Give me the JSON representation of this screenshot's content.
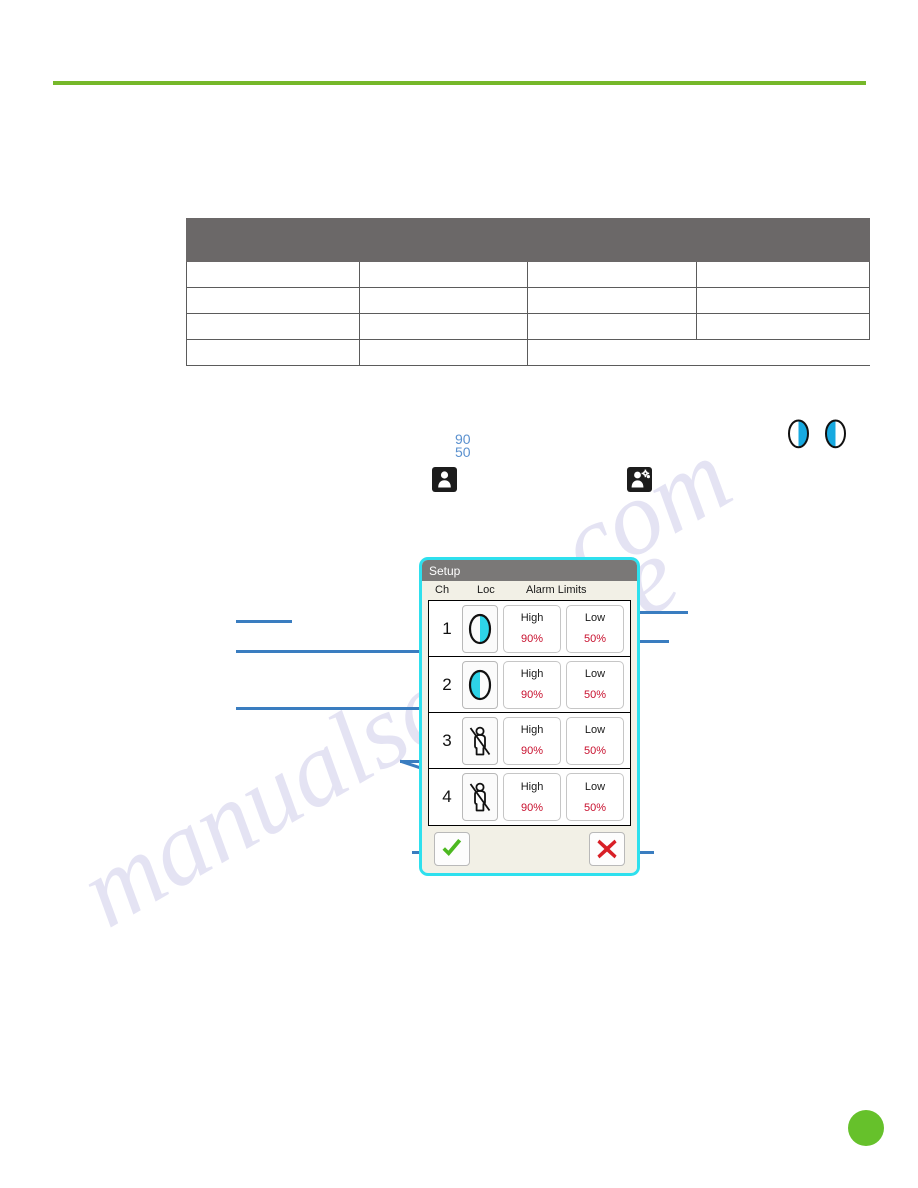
{
  "page": {
    "rule_color": "#76b82a",
    "marker_color": "#66c12b",
    "watermark_text_left": "manualsarchive",
    "watermark_text_right": "ive.com"
  },
  "data_table": {
    "header_band_color": "#6b6868",
    "columns": [
      "",
      "",
      "",
      ""
    ],
    "rows": [
      [
        "",
        "",
        "",
        ""
      ],
      [
        "",
        "",
        "",
        ""
      ],
      [
        "",
        "",
        "",
        ""
      ],
      [
        "",
        "",
        "",
        ""
      ]
    ]
  },
  "loose_icons": {
    "limits_readout": {
      "high": "90",
      "low": "50"
    },
    "patient_icon_name": "patient-icon",
    "patient_settings_icon_name": "patient-settings-icon",
    "location_right_icon_name": "location-right-icon",
    "location_left_icon_name": "location-left-icon"
  },
  "setup_dialog": {
    "title": "Setup",
    "columns": {
      "channel": "Ch",
      "location": "Loc",
      "alarm_limits": "Alarm Limits"
    },
    "accent_color": "#2ee0ee",
    "limit_value_color": "#c8102e",
    "channels": [
      {
        "number": "1",
        "location_icon": "oval-fill-right-icon",
        "high_label": "High",
        "high_value": "90%",
        "low_label": "Low",
        "low_value": "50%"
      },
      {
        "number": "2",
        "location_icon": "oval-fill-left-icon",
        "high_label": "High",
        "high_value": "90%",
        "low_label": "Low",
        "low_value": "50%"
      },
      {
        "number": "3",
        "location_icon": "person-disabled-icon",
        "high_label": "High",
        "high_value": "90%",
        "low_label": "Low",
        "low_value": "50%"
      },
      {
        "number": "4",
        "location_icon": "person-disabled-icon",
        "high_label": "High",
        "high_value": "90%",
        "low_label": "Low",
        "low_value": "50%"
      }
    ],
    "actions": {
      "confirm_icon": "check-icon",
      "cancel_icon": "cross-icon"
    }
  }
}
